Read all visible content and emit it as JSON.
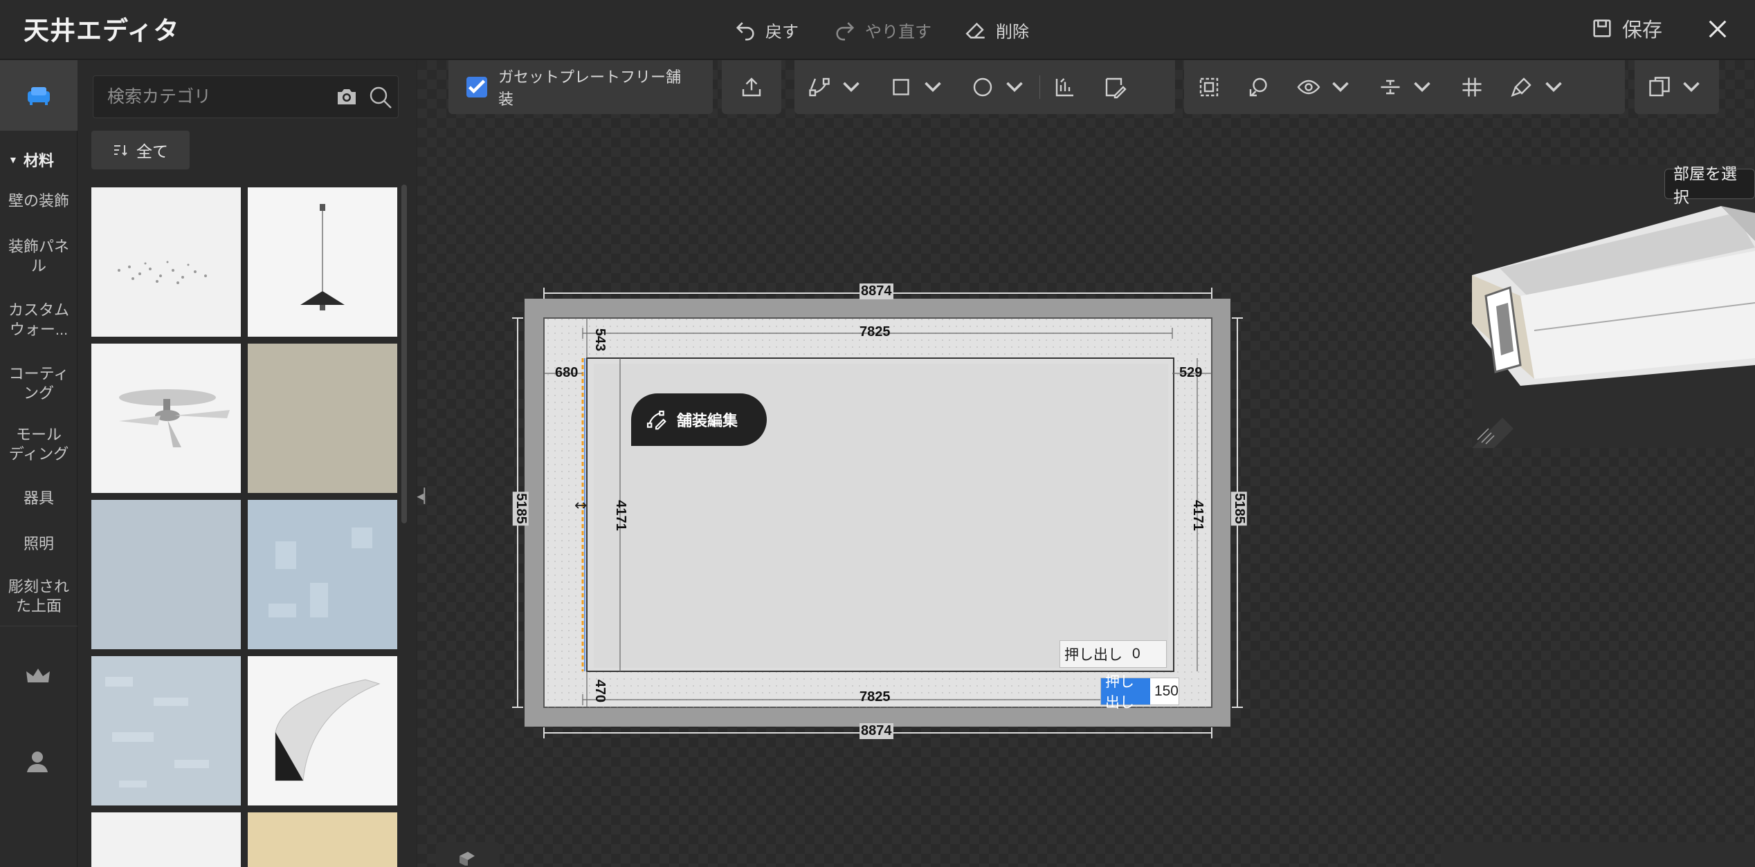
{
  "header": {
    "title": "天井エディタ",
    "undo_label": "戻す",
    "redo_label": "やり直す",
    "delete_label": "削除",
    "save_label": "保存"
  },
  "search": {
    "placeholder": "検索カテゴリ"
  },
  "filter": {
    "all_label": "全て"
  },
  "sidebar": {
    "section_label": "材料",
    "items": [
      {
        "label": "壁の装飾"
      },
      {
        "label": "装飾パネル"
      },
      {
        "label": "カスタムウォー..."
      },
      {
        "label": "コーティング"
      },
      {
        "label": "モールディング"
      },
      {
        "label": "器具"
      },
      {
        "label": "照明"
      },
      {
        "label": "彫刻された上面"
      }
    ]
  },
  "toolbar": {
    "gasset_label": "ガセットプレートフリー舗装",
    "gasset_checked": true
  },
  "canvas": {
    "room_select_label": "部屋を選択",
    "pave_edit_label": "舗装編集",
    "extrude_label": "押し出し",
    "extrude_inner_value": "0",
    "extrude_outer_value": "150",
    "dimensions": {
      "outer_width_top": "8874",
      "outer_width_bottom": "8874",
      "inner_width_top": "7825",
      "inner_width_bottom": "7825",
      "outer_height_left": "5185",
      "outer_height_right": "5185",
      "inner_height_left": "4171",
      "inner_height_right": "4171",
      "top_offset": "543",
      "bottom_offset": "470",
      "left_offset": "680",
      "right_offset": "529"
    }
  },
  "colors": {
    "accent": "#3d7ee6",
    "selection_edge": "#f0a020",
    "panel_bg": "#2a2a2a"
  }
}
